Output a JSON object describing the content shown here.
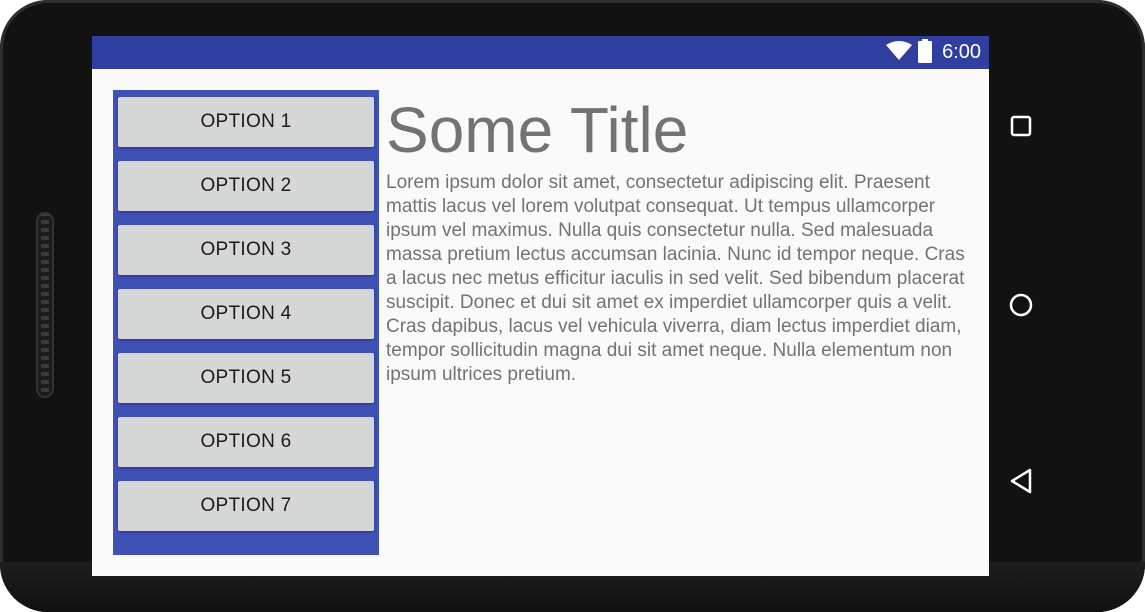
{
  "status_bar": {
    "time": "6:00",
    "icons": [
      "wifi-icon",
      "battery-icon"
    ],
    "color": "#303f9f"
  },
  "sidebar": {
    "color": "#3f51b5",
    "options": [
      "OPTION 1",
      "OPTION 2",
      "OPTION 3",
      "OPTION 4",
      "OPTION 5",
      "OPTION 6",
      "OPTION 7"
    ]
  },
  "content": {
    "title": "Some Title",
    "body": "Lorem ipsum dolor sit amet, consectetur adipiscing elit. Praesent mattis lacus vel lorem volutpat consequat. Ut tempus ullamcorper ipsum vel maximus. Nulla quis consectetur nulla. Sed malesuada massa pretium lectus accumsan lacinia. Nunc id tempor neque. Cras a lacus nec metus efficitur iaculis in sed velit. Sed bibendum placerat suscipit. Donec et dui sit amet ex imperdiet ullamcorper quis a velit. Cras dapibus, lacus vel vehicula viverra, diam lectus imperdiet diam, tempor sollicitudin magna dui sit amet neque. Nulla elementum non ipsum ultrices pretium."
  },
  "nav_bar": {
    "buttons": [
      "recents-icon",
      "home-icon",
      "back-icon"
    ]
  }
}
